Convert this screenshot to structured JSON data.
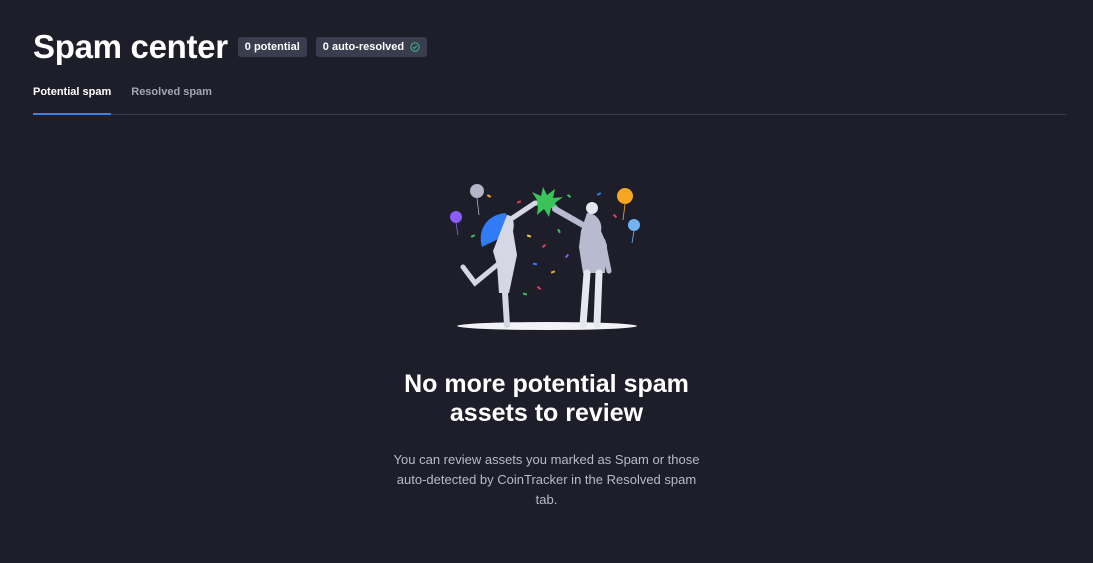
{
  "header": {
    "title": "Spam center",
    "badges": {
      "potential": "0 potential",
      "auto_resolved": "0 auto-resolved"
    }
  },
  "tabs": [
    {
      "label": "Potential spam",
      "active": true
    },
    {
      "label": "Resolved spam",
      "active": false
    }
  ],
  "empty_state": {
    "illustration": "celebration-high-five-illustration",
    "title": "No more potential spam assets to review",
    "description": "You can review assets you marked as Spam or those auto-detected by CoinTracker in the Resolved spam tab."
  },
  "colors": {
    "background": "#1e1e2a",
    "badge_bg": "#3a3d4d",
    "active_tab_underline": "#3b82e8",
    "check_green": "#3fb68b"
  }
}
